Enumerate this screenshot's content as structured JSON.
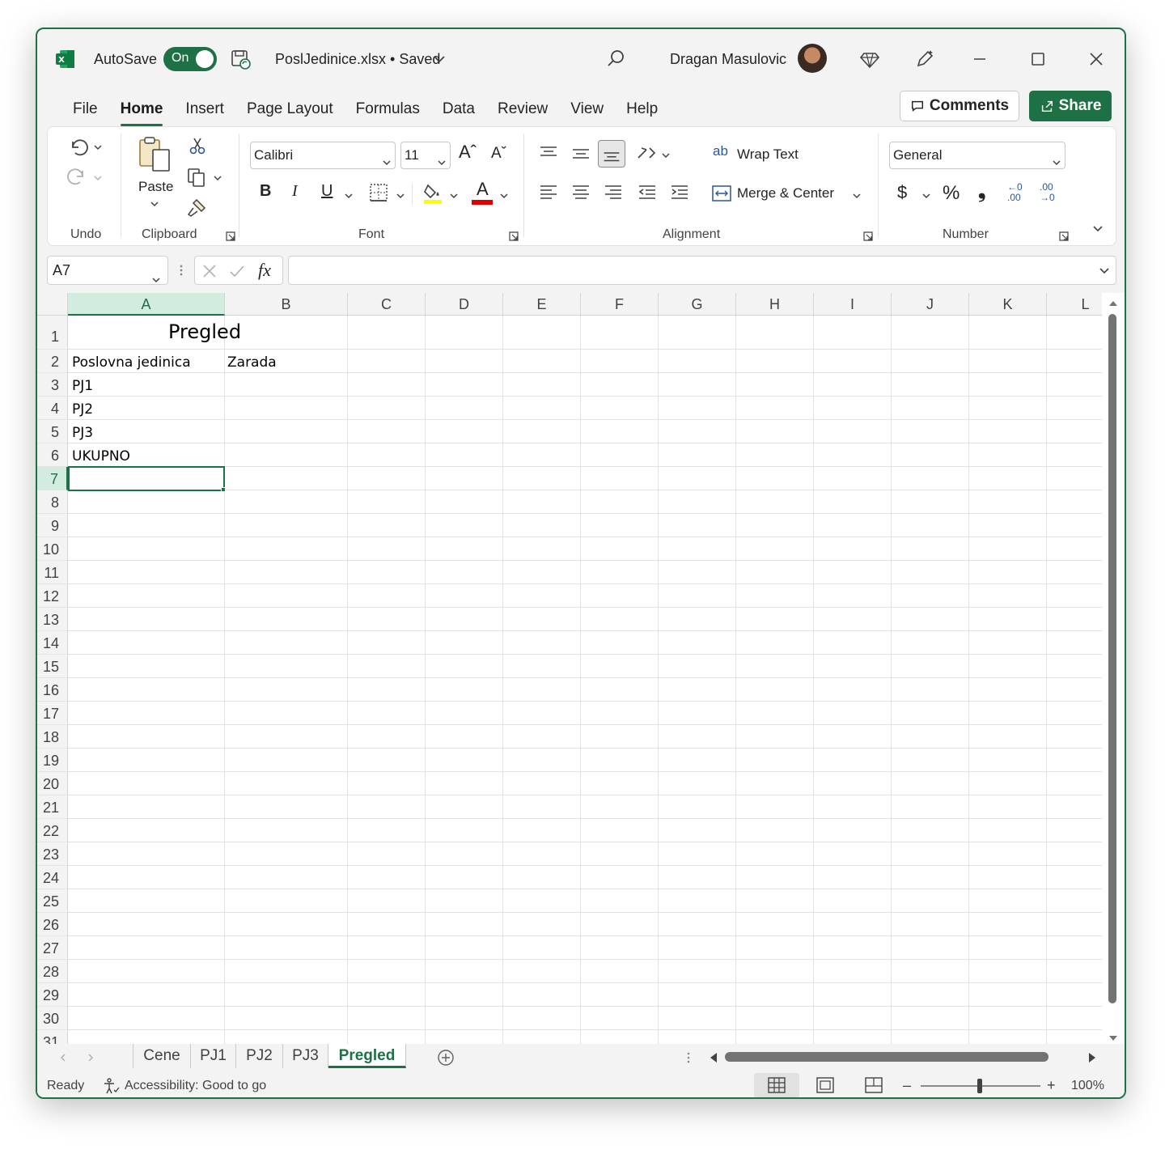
{
  "titlebar": {
    "autosave_label": "AutoSave",
    "autosave_state": "On",
    "filename": "PoslJedinice.xlsx • Saved",
    "user_name": "Dragan Masulovic"
  },
  "menu": {
    "tabs": [
      {
        "label": "File"
      },
      {
        "label": "Home"
      },
      {
        "label": "Insert"
      },
      {
        "label": "Page Layout"
      },
      {
        "label": "Formulas"
      },
      {
        "label": "Data"
      },
      {
        "label": "Review"
      },
      {
        "label": "View"
      },
      {
        "label": "Help"
      }
    ],
    "active_tab": "Home",
    "comments_label": "Comments",
    "share_label": "Share"
  },
  "ribbon": {
    "groups": {
      "undo": "Undo",
      "clipboard": "Clipboard",
      "font": "Font",
      "alignment": "Alignment",
      "number": "Number"
    },
    "paste_label": "Paste",
    "font_name": "Calibri",
    "font_size": "11",
    "wrap_text_label": "Wrap Text",
    "merge_center_label": "Merge & Center",
    "number_format": "General",
    "currency_symbol": "$",
    "percent_symbol": "%",
    "comma_symbol": "❟",
    "bold_glyph": "B",
    "italic_glyph": "I",
    "underline_glyph": "U",
    "font_color_glyph": "A",
    "grow_font_glyph": "Aˆ",
    "shrink_font_glyph": "Aˇ",
    "increase_decimal_glyph": "←0 .00",
    "decrease_decimal_glyph": ".00 →0",
    "wrap_glyph": "ab",
    "highlight_color": "#ffff00",
    "font_color": "#e00000"
  },
  "formula_bar": {
    "name_box": "A7",
    "fx_label": "fx",
    "formula": ""
  },
  "grid": {
    "columns": [
      "A",
      "B",
      "C",
      "D",
      "E",
      "F",
      "G",
      "H",
      "I",
      "J",
      "K",
      "L"
    ],
    "rows": [
      "1",
      "2",
      "3",
      "4",
      "5",
      "6",
      "7",
      "8",
      "9",
      "10",
      "11",
      "12",
      "13",
      "14",
      "15",
      "16",
      "17",
      "18",
      "19",
      "20",
      "21",
      "22",
      "23",
      "24",
      "25",
      "26",
      "27",
      "28",
      "29",
      "30",
      "31"
    ],
    "selected_cell": "A7",
    "cells": {
      "title": "Pregled",
      "a2": "Poslovna jedinica",
      "b2": "Zarada",
      "a3": "PJ1",
      "a4": "PJ2",
      "a5": "PJ3",
      "a6": "UKUPNO"
    }
  },
  "sheets": {
    "tabs": [
      {
        "label": "Cene"
      },
      {
        "label": "PJ1"
      },
      {
        "label": "PJ2"
      },
      {
        "label": "PJ3"
      },
      {
        "label": "Pregled"
      }
    ],
    "active": "Pregled"
  },
  "statusbar": {
    "ready": "Ready",
    "accessibility": "Accessibility: Good to go",
    "zoom": "100%"
  },
  "colors": {
    "accent": "#1e7145"
  }
}
